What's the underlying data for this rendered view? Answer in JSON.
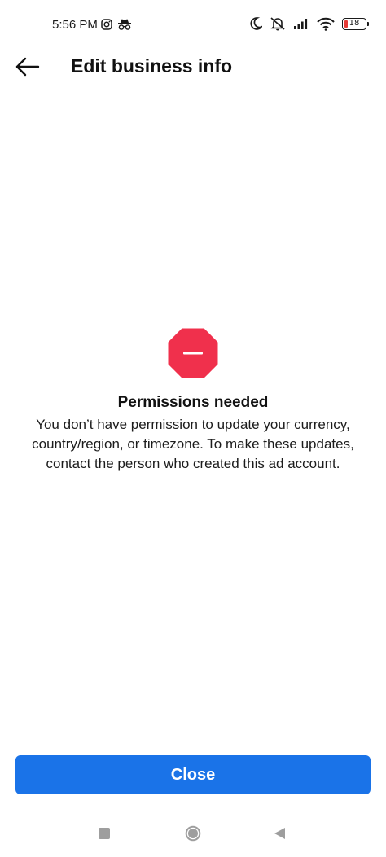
{
  "status_bar": {
    "time": "5:56 PM",
    "battery_level": "18",
    "icons": [
      "instagram-icon",
      "incognito-icon",
      "moon-icon",
      "mute-icon",
      "signal-icon",
      "wifi-icon",
      "battery-icon"
    ],
    "battery_color": "#e53935"
  },
  "header": {
    "title": "Edit business info",
    "back_icon": "arrow-left-icon"
  },
  "message": {
    "icon": "stop-icon",
    "icon_color": "#f0304c",
    "title": "Permissions needed",
    "body": "You don’t have permission to update your currency, country/region, or timezone. To make these updates, contact the person who created this ad account."
  },
  "footer": {
    "close_label": "Close",
    "button_color": "#1a73e8"
  },
  "nav_bar": {
    "icons": [
      "recents-icon",
      "home-icon",
      "back-icon"
    ]
  }
}
